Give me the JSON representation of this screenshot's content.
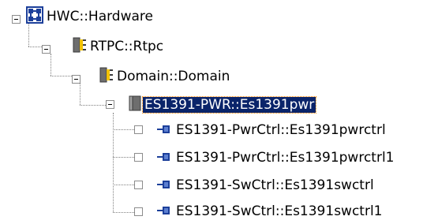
{
  "tree": {
    "root": {
      "label": "HWC::Hardware",
      "icon": "hardware-grid-icon",
      "expanded": true
    },
    "level1": {
      "label": "RTPC::Rtpc",
      "icon": "module-block-icon",
      "expanded": true
    },
    "level2": {
      "label": "Domain::Domain",
      "icon": "domain-block-icon",
      "expanded": true
    },
    "level3": {
      "label": "ES1391-PWR::Es1391pwr",
      "icon": "board-icon",
      "expanded": true,
      "selected": true
    },
    "leaves": [
      {
        "label": "ES1391-PwrCtrl::Es1391pwrctrl",
        "icon": "channel-icon"
      },
      {
        "label": "ES1391-PwrCtrl::Es1391pwrctrl1",
        "icon": "channel-icon"
      },
      {
        "label": "ES1391-SwCtrl::Es1391swctrl",
        "icon": "channel-icon"
      },
      {
        "label": "ES1391-SwCtrl::Es1391swctrl1",
        "icon": "channel-icon"
      }
    ]
  },
  "colors": {
    "selection_bg": "#0a246a",
    "icon_blue": "#1c3f9a",
    "icon_gray": "#6e6e6e",
    "icon_yellow": "#f2c200"
  }
}
